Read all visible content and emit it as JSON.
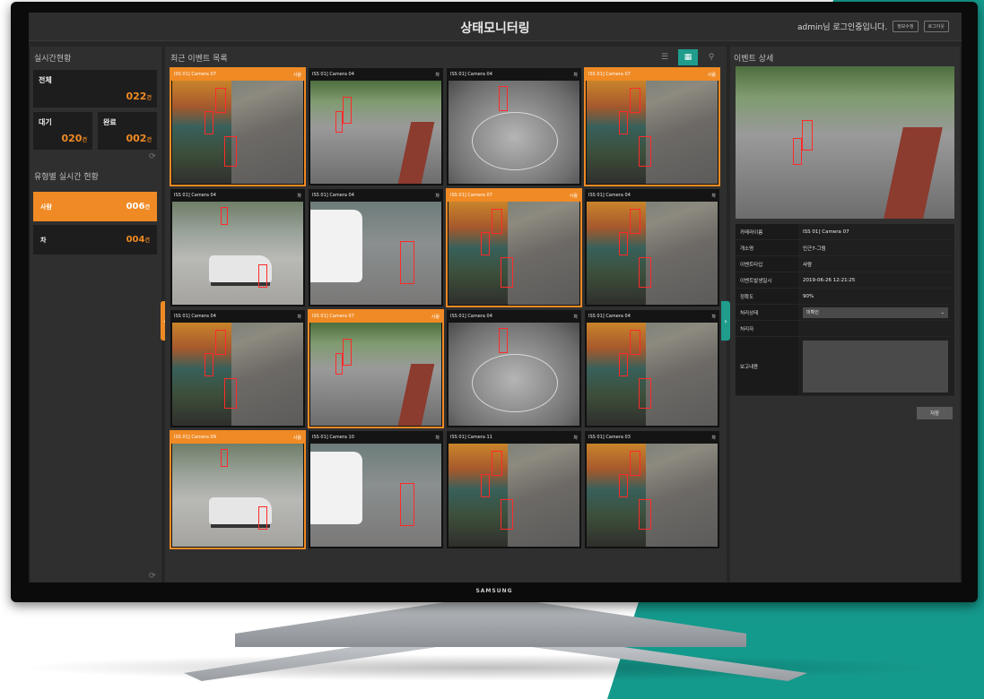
{
  "header": {
    "title": "상태모니터링",
    "user_text": "admin님 로그인중입니다.",
    "btn_1": "정보수정",
    "btn_2": "로그아웃"
  },
  "realtime": {
    "title": "실시간현황",
    "total_label": "전체",
    "total_value": "022",
    "wait_label": "대기",
    "wait_value": "020",
    "done_label": "완료",
    "done_value": "002",
    "unit": "건"
  },
  "by_type": {
    "title": "유형별 실시간 현황",
    "rows": [
      {
        "label": "사람",
        "value": "006",
        "unit": "건"
      },
      {
        "label": "차",
        "value": "004",
        "unit": "건"
      }
    ]
  },
  "events": {
    "title": "최근 이벤트 목록",
    "view_icons": [
      "list-view-icon",
      "grid-view-icon",
      "map-pin-icon"
    ],
    "cells": [
      {
        "camera": "ISS 01] Camera 07",
        "type": "사람",
        "alert": true,
        "scene": "street"
      },
      {
        "camera": "ISS 01] Camera 04",
        "type": "차",
        "alert": false,
        "scene": "road"
      },
      {
        "camera": "ISS 01] Camera 04",
        "type": "차",
        "alert": false,
        "scene": "plaza"
      },
      {
        "camera": "ISS 01] Camera 07",
        "type": "사람",
        "alert": true,
        "scene": "street"
      },
      {
        "camera": "ISS 01] Camera 04",
        "type": "차",
        "alert": false,
        "scene": "car"
      },
      {
        "camera": "ISS 01] Camera 04",
        "type": "차",
        "alert": false,
        "scene": "bus"
      },
      {
        "camera": "ISS 01] Camera 07",
        "type": "사람",
        "alert": true,
        "scene": "street"
      },
      {
        "camera": "ISS 01] Camera 04",
        "type": "차",
        "alert": false,
        "scene": "street"
      },
      {
        "camera": "ISS 01] Camera 04",
        "type": "차",
        "alert": false,
        "scene": "street"
      },
      {
        "camera": "ISS 01] Camera 07",
        "type": "사람",
        "alert": true,
        "scene": "road"
      },
      {
        "camera": "ISS 01] Camera 04",
        "type": "차",
        "alert": false,
        "scene": "plaza"
      },
      {
        "camera": "ISS 01] Camera 04",
        "type": "차",
        "alert": false,
        "scene": "street"
      },
      {
        "camera": "ISS 01] Camera 09",
        "type": "사람",
        "alert": true,
        "scene": "car"
      },
      {
        "camera": "ISS 01] Camera 10",
        "type": "차",
        "alert": false,
        "scene": "bus"
      },
      {
        "camera": "ISS 01] Camera 11",
        "type": "차",
        "alert": false,
        "scene": "street"
      },
      {
        "camera": "ISS 01] Camera 03",
        "type": "차",
        "alert": false,
        "scene": "street"
      }
    ]
  },
  "detail": {
    "title": "이벤트 상세",
    "rows": [
      {
        "key": "카메라이름",
        "value": "ISS 01] Camera 07"
      },
      {
        "key": "개소명",
        "value": "인근7-그림"
      },
      {
        "key": "이벤트타입",
        "value": "사람"
      },
      {
        "key": "이벤트발생일시",
        "value": "2019-06-26 12:21:25"
      },
      {
        "key": "정확도",
        "value": "90%"
      }
    ],
    "status_key": "처리상태",
    "status_value": "미확인",
    "handler_key": "처리자",
    "handler_value": "",
    "report_key": "보고내용",
    "save_label": "저장"
  },
  "brand": "SAMSUNG",
  "colors": {
    "accent_orange": "#f08a24",
    "accent_teal": "#1f9c8c",
    "detect_box": "#ff2a2a"
  }
}
